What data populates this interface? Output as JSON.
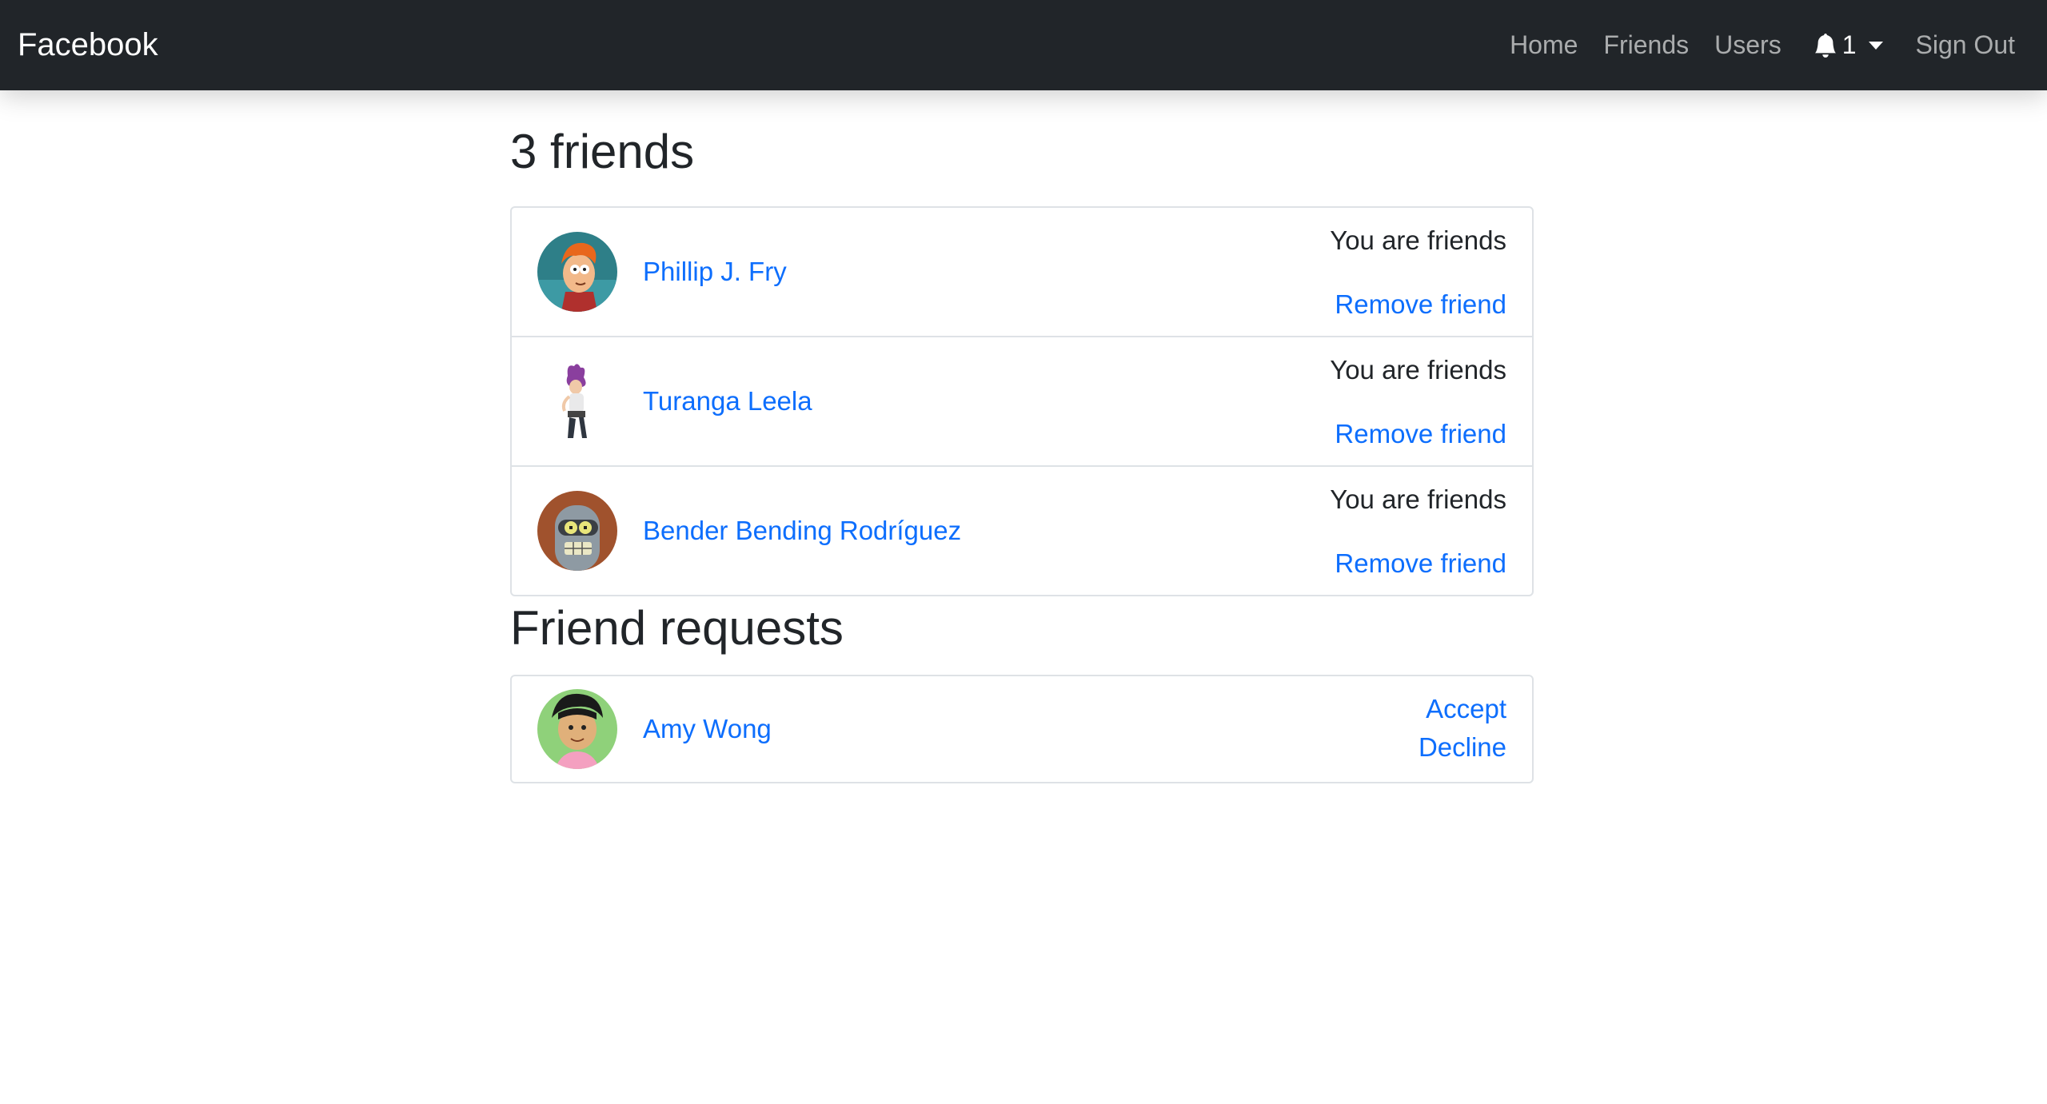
{
  "navbar": {
    "brand": "Facebook",
    "links": {
      "home": "Home",
      "friends": "Friends",
      "users": "Users",
      "sign_out": "Sign Out"
    },
    "notifications": {
      "count": "1",
      "icon": "bell-icon"
    }
  },
  "friends_section": {
    "title": "3 friends",
    "items": [
      {
        "name": "Phillip J. Fry",
        "status": "You are friends",
        "action": "Remove friend"
      },
      {
        "name": "Turanga Leela",
        "status": "You are friends",
        "action": "Remove friend"
      },
      {
        "name": "Bender Bending Rodríguez",
        "status": "You are friends",
        "action": "Remove friend"
      }
    ]
  },
  "requests_section": {
    "title": "Friend requests",
    "items": [
      {
        "name": "Amy Wong",
        "accept": "Accept",
        "decline": "Decline"
      }
    ]
  },
  "colors": {
    "navbar_bg": "#212529",
    "link": "#0d6efd",
    "border": "#dee2e6"
  }
}
